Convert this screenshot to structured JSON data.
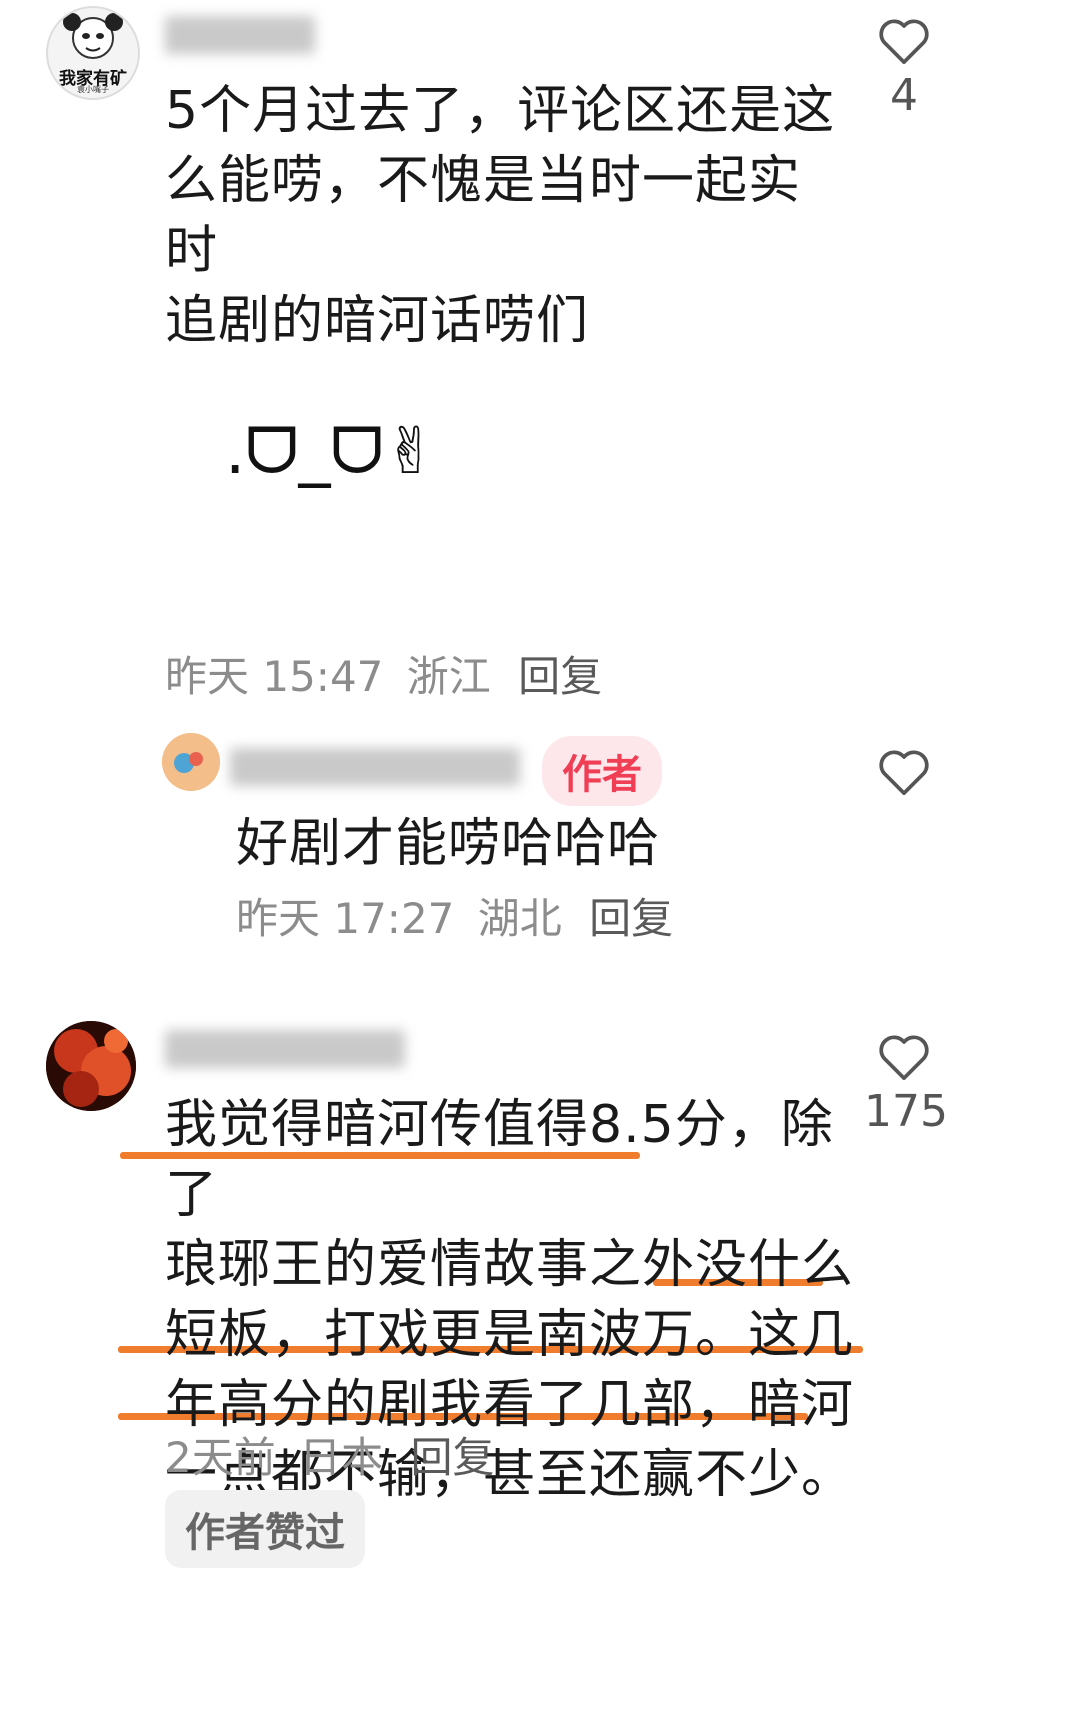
{
  "comments": [
    {
      "avatar_caption": "我家有矿",
      "avatar_subcaption": "袁小嘴子",
      "text_lines": [
        "5个月过去了，评论区还是这",
        "么能唠，不愧是当时一起实时",
        "追剧的暗河话唠们"
      ],
      "emoji": ".ᗜ_ᗜ✌",
      "time": "昨天 15:47",
      "location": "浙江",
      "reply": "回复",
      "likes": "4",
      "replies": [
        {
          "badge": "作者",
          "text": "好剧才能唠哈哈哈",
          "time": "昨天 17:27",
          "location": "湖北",
          "reply": "回复"
        }
      ]
    },
    {
      "text_lines": [
        "我觉得暗河传值得8.5分，除了",
        "琅琊王的爱情故事之外没什么",
        "短板，打戏更是南波万。这几",
        "年高分的剧我看了几部，暗河",
        "一点都不输，甚至还赢不少。"
      ],
      "time": "2天前",
      "location": "日本",
      "reply": "回复",
      "likes": "175",
      "author_liked": "作者赞过"
    }
  ],
  "colors": {
    "accent_underline": "#f07d2e",
    "author_badge": "#f03e55"
  }
}
